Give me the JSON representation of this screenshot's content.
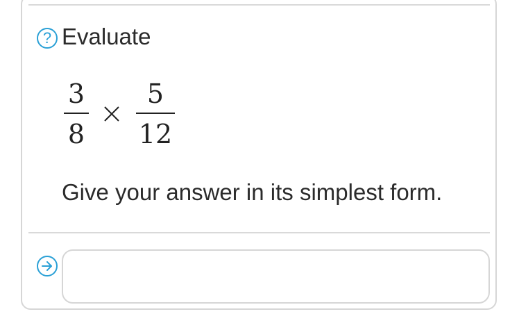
{
  "question": {
    "prompt": "Evaluate",
    "icon": "question-circle-icon",
    "expression": {
      "left": {
        "numerator": "3",
        "denominator": "8"
      },
      "operator": "×",
      "right": {
        "numerator": "5",
        "denominator": "12"
      }
    },
    "instruction": "Give your answer in its simplest form."
  },
  "answer": {
    "value": "",
    "placeholder": "",
    "submit_icon": "arrow-right-circle-icon"
  },
  "colors": {
    "accent": "#2aa0d6",
    "border": "#d6d6d6",
    "text": "#2b2b2b"
  }
}
